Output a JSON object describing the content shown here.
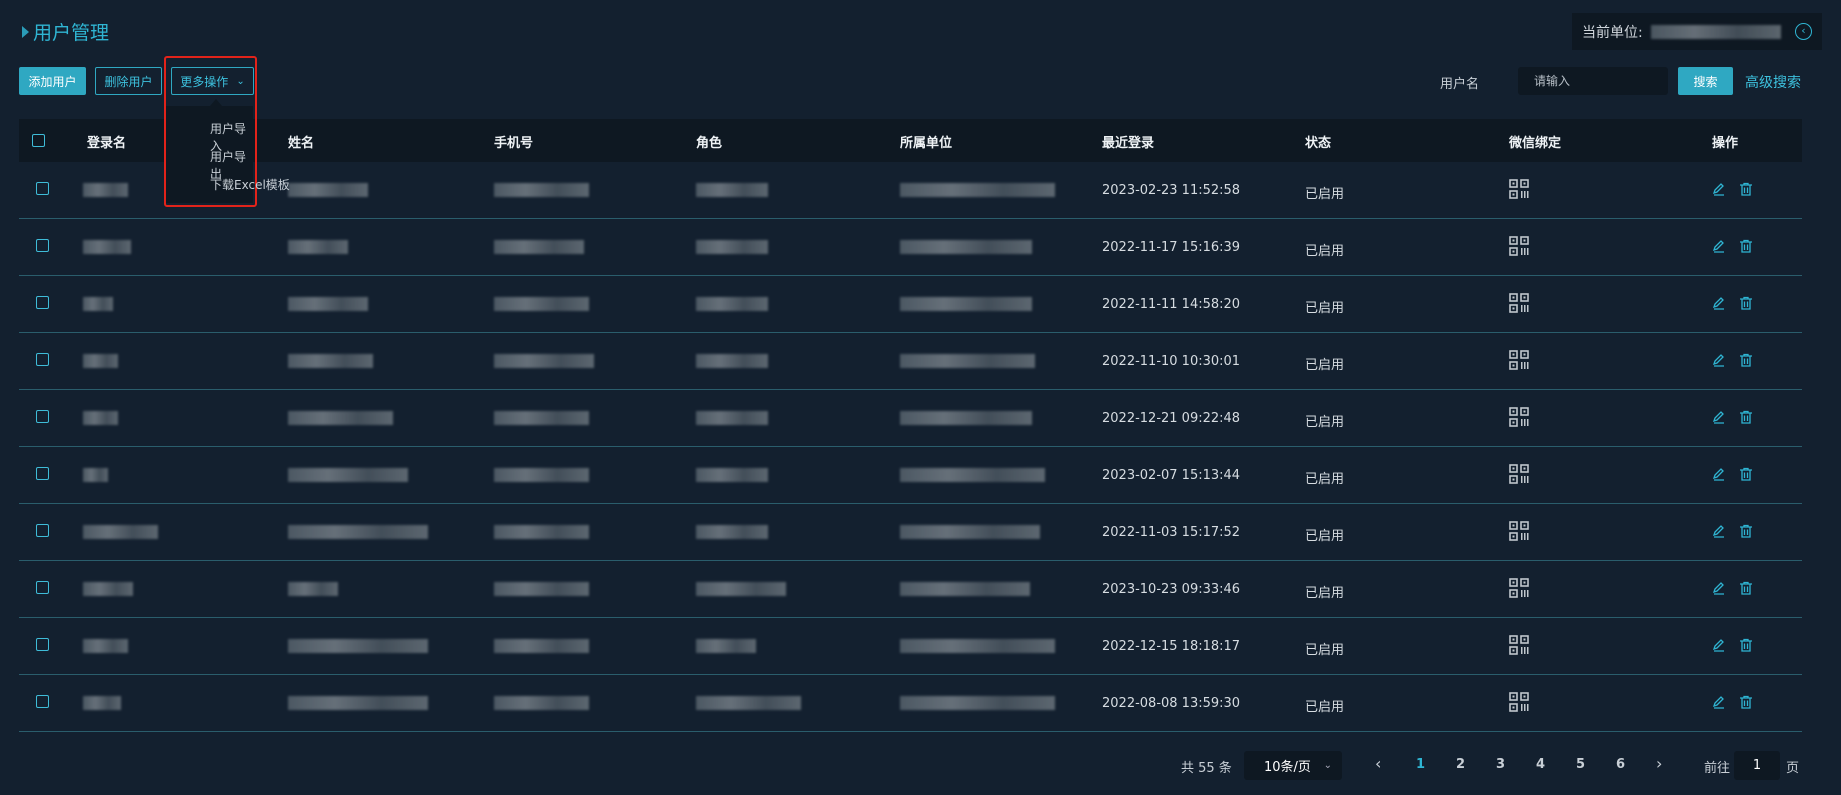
{
  "page": {
    "title": "用户管理",
    "current_unit_label": "当前单位:"
  },
  "toolbar": {
    "add": "添加用户",
    "delete": "删除用户",
    "more": "更多操作"
  },
  "more_menu": [
    "用户导入",
    "用户导出",
    "下载Excel模板"
  ],
  "search": {
    "label": "用户名",
    "placeholder": "请输入",
    "button": "搜索",
    "advanced": "高级搜索"
  },
  "table": {
    "columns": [
      "登录名",
      "姓名",
      "手机号",
      "角色",
      "所属单位",
      "最近登录",
      "状态",
      "微信绑定",
      "操作"
    ],
    "rows": [
      {
        "last_login": "2023-02-23 11:52:58",
        "status": "已启用"
      },
      {
        "last_login": "2022-11-17 15:16:39",
        "status": "已启用"
      },
      {
        "last_login": "2022-11-11 14:58:20",
        "status": "已启用"
      },
      {
        "last_login": "2022-11-10 10:30:01",
        "status": "已启用"
      },
      {
        "last_login": "2022-12-21 09:22:48",
        "status": "已启用"
      },
      {
        "last_login": "2023-02-07 15:13:44",
        "status": "已启用"
      },
      {
        "last_login": "2022-11-03 15:17:52",
        "status": "已启用"
      },
      {
        "last_login": "2023-10-23 09:33:46",
        "status": "已启用"
      },
      {
        "last_login": "2022-12-15 18:18:17",
        "status": "已启用"
      },
      {
        "last_login": "2022-08-08 13:59:30",
        "status": "已启用"
      }
    ]
  },
  "pagination": {
    "total": "共 55 条",
    "page_size": "10条/页",
    "pages": [
      "1",
      "2",
      "3",
      "4",
      "5",
      "6"
    ],
    "current": "1",
    "goto_label": "前往",
    "goto_value": "1",
    "goto_suffix": "页"
  },
  "colors": {
    "accent": "#2fa8c2",
    "background": "#13202f",
    "header": "#0e1822",
    "highlight": "#e2231a"
  }
}
